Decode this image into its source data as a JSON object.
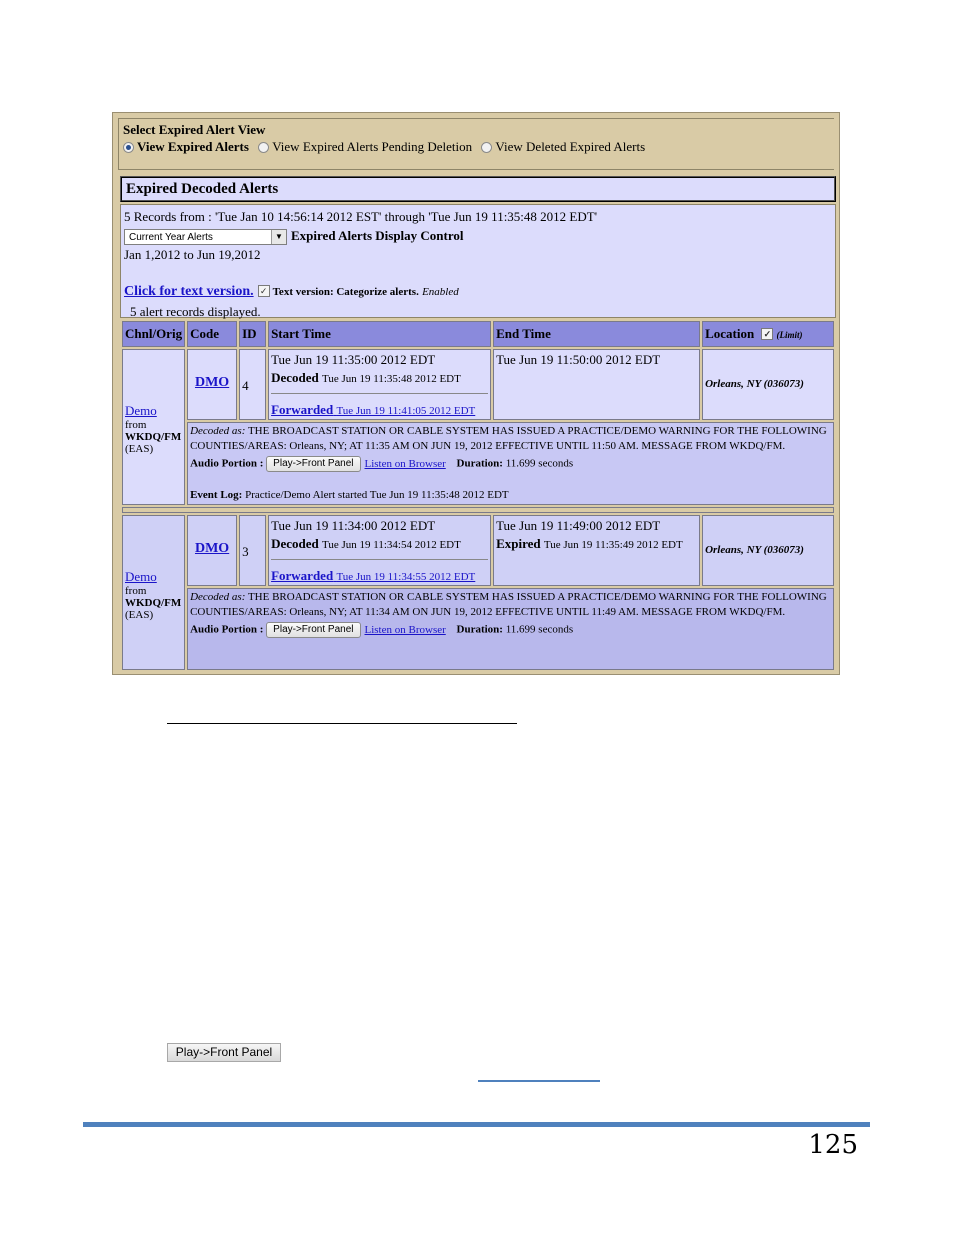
{
  "view_selector": {
    "title": "Select Expired Alert View",
    "options": [
      {
        "label": "View Expired Alerts",
        "selected": true
      },
      {
        "label": "View Expired Alerts Pending Deletion",
        "selected": false
      },
      {
        "label": "View Deleted Expired Alerts",
        "selected": false
      }
    ]
  },
  "section_title": "Expired Decoded Alerts",
  "info": {
    "records_line": "5 Records from : 'Tue Jan 10 14:56:14 2012 EST' through 'Tue Jun 19 11:35:48 2012 EDT'",
    "display_select_value": "Current Year Alerts",
    "display_control_label": "Expired Alerts Display Control",
    "date_range": "Jan 1,2012 to Jun 19,2012",
    "text_version_link": "Click for text version.",
    "categorize_checked": true,
    "categorize_label": "Text version: Categorize alerts.",
    "categorize_state": "Enabled",
    "displayed_count": "5 alert records displayed."
  },
  "table": {
    "headers": {
      "chnl": "Chnl/Orig",
      "code": "Code",
      "id": "ID",
      "start": "Start Time",
      "end": "End Time",
      "location": "Location",
      "limit_label": "(Limit)",
      "limit_checked": true
    },
    "rows": [
      {
        "chnl_link": "Demo",
        "chnl_from": "from",
        "chnl_station": "WKDQ/FM",
        "chnl_source": "(EAS)",
        "code": "DMO",
        "id": "4",
        "start_time": "Tue Jun 19 11:35:00 2012 EDT",
        "decoded_label": "Decoded",
        "decoded_time": "Tue Jun 19 11:35:48 2012 EDT",
        "forwarded_label": "Forwarded",
        "forwarded_time": "Tue Jun 19 11:41:05 2012 EDT",
        "end_time": "Tue Jun 19 11:50:00 2012 EDT",
        "expired_label": "",
        "expired_time": "",
        "location": "Orleans, NY (036073)",
        "decoded_as_label": "Decoded as:",
        "message": "THE BROADCAST STATION OR CABLE SYSTEM HAS ISSUED A PRACTICE/DEMO WARNING FOR THE FOLLOWING COUNTIES/AREAS: Orleans, NY; AT 11:35 AM ON JUN 19, 2012 EFFECTIVE UNTIL 11:50 AM. MESSAGE FROM WKDQ/FM.",
        "audio_label": "Audio Portion :",
        "play_button": "Play->Front Panel",
        "listen_link": "Listen on Browser",
        "duration_label": "Duration:",
        "duration_value": "11.699 seconds",
        "event_log_label": "Event Log:",
        "event_log": "Practice/Demo Alert started Tue Jun 19 11:35:48 2012 EDT"
      },
      {
        "chnl_link": "Demo",
        "chnl_from": "from",
        "chnl_station": "WKDQ/FM",
        "chnl_source": "(EAS)",
        "code": "DMO",
        "id": "3",
        "start_time": "Tue Jun 19 11:34:00 2012 EDT",
        "decoded_label": "Decoded",
        "decoded_time": "Tue Jun 19 11:34:54 2012 EDT",
        "forwarded_label": "Forwarded",
        "forwarded_time": "Tue Jun 19 11:34:55 2012 EDT",
        "end_time": "Tue Jun 19 11:49:00 2012 EDT",
        "expired_label": "Expired",
        "expired_time": "Tue Jun 19 11:35:49 2012 EDT",
        "location": "Orleans, NY (036073)",
        "decoded_as_label": "Decoded as:",
        "message": "THE BROADCAST STATION OR CABLE SYSTEM HAS ISSUED A PRACTICE/DEMO WARNING FOR THE FOLLOWING COUNTIES/AREAS: Orleans, NY; AT 11:34 AM ON JUN 19, 2012 EFFECTIVE UNTIL 11:49 AM. MESSAGE FROM WKDQ/FM.",
        "audio_label": "Audio Portion :",
        "play_button": "Play->Front Panel",
        "listen_link": "Listen on Browser",
        "duration_label": "Duration:",
        "duration_value": "11.699 seconds"
      }
    ]
  },
  "document": {
    "inline_button": "Play->Front Panel",
    "page_number": "125",
    "accent_color": "#4f81bd"
  }
}
